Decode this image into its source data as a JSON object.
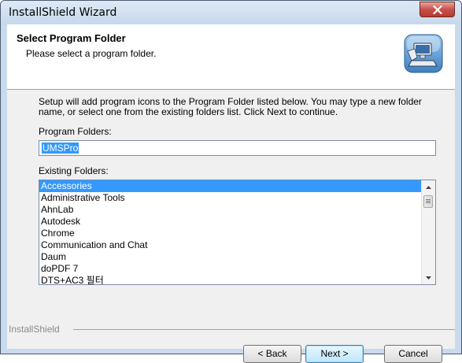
{
  "window": {
    "title": "InstallShield Wizard",
    "close_icon": "close-icon"
  },
  "header": {
    "title": "Select Program Folder",
    "subtitle": "Please select a program folder.",
    "icon": "computer-setup-icon"
  },
  "body": {
    "description": "Setup will add program icons to the Program Folder listed below.  You may type a new folder name, or select one from the existing folders list.  Click Next to continue.",
    "program_folders_label": "Program Folders:",
    "program_folder_value": "UMSPro",
    "existing_folders_label": "Existing Folders:",
    "existing_folders": [
      "Accessories",
      "Administrative Tools",
      "AhnLab",
      "Autodesk",
      "Chrome",
      "Communication and Chat",
      "Daum",
      "doPDF 7",
      "DTS+AC3 필터"
    ],
    "selected_index": 0
  },
  "footer": {
    "brand": "InstallShield",
    "back_label": "< Back",
    "next_label": "Next >",
    "cancel_label": "Cancel"
  },
  "colors": {
    "selection": "#3399ff",
    "frame": "#c9daec",
    "close_button": "#c75050"
  }
}
